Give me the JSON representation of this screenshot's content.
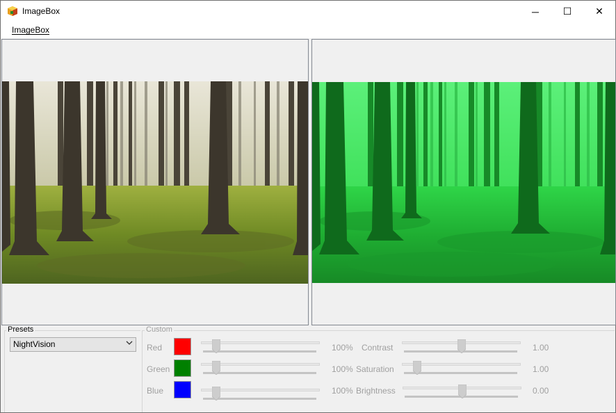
{
  "window": {
    "title": "ImageBox",
    "controls": {
      "minimize": "─",
      "maximize": "☐",
      "close": "✕"
    }
  },
  "menu": {
    "items": [
      {
        "label": "ImageBox",
        "mnemonic": "I"
      }
    ]
  },
  "presets": {
    "group_label": "Presets",
    "selected": "NightVision"
  },
  "custom": {
    "group_label": "Custom",
    "channels": [
      {
        "label": "Red",
        "color": "#ff0000",
        "value": "100%",
        "level": 0.1
      },
      {
        "label": "Green",
        "color": "#008000",
        "value": "100%",
        "level": 0.1
      },
      {
        "label": "Blue",
        "color": "#0000ff",
        "value": "100%",
        "level": 0.1
      }
    ],
    "adjustments": [
      {
        "label": "Contrast",
        "value": "1.00",
        "level": 0.5
      },
      {
        "label": "Saturation",
        "value": "1.00",
        "level": 0.1
      },
      {
        "label": "Brightness",
        "value": "0.00",
        "level": 0.5
      }
    ]
  },
  "images": {
    "original": {
      "icon": "forest-photo"
    },
    "filtered": {
      "icon": "forest-photo-nightvision",
      "tint": "#1ee63c"
    }
  }
}
